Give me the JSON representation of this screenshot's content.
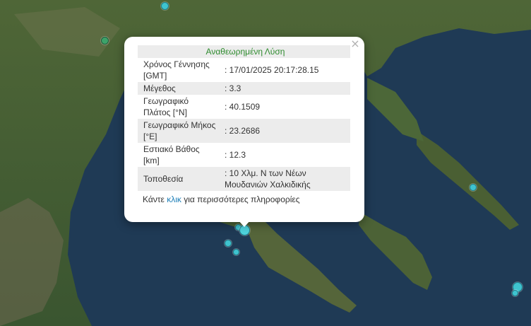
{
  "popup": {
    "title": "Αναθεωρημένη Λύση",
    "close_symbol": "×",
    "rows": [
      {
        "label": "Χρόνος Γέννησης [GMT]",
        "value": ": 17/01/2025 20:17:28.15"
      },
      {
        "label": "Μέγεθος",
        "value": ": 3.3"
      },
      {
        "label": "Γεωγραφικό Πλάτος [°N]",
        "value": ": 40.1509"
      },
      {
        "label": "Γεωγραφικό Μήκος [°E]",
        "value": ": 23.2686"
      },
      {
        "label": "Εστιακό Βάθος [km]",
        "value": ": 12.3"
      },
      {
        "label": "Τοποθεσία",
        "value": ": 10 Χλμ. Ν των Νέων Μουδανιών Χαλκιδικής"
      }
    ],
    "footer_before": "Κάντε ",
    "footer_link": "κλικ",
    "footer_after": " για περισσότερες πληροφορίες"
  },
  "map": {
    "water_color": "#1f3a55",
    "land_color": "#3f5a2e",
    "marker_color": "#3fc3cf",
    "older_marker_color": "#3da36a"
  }
}
